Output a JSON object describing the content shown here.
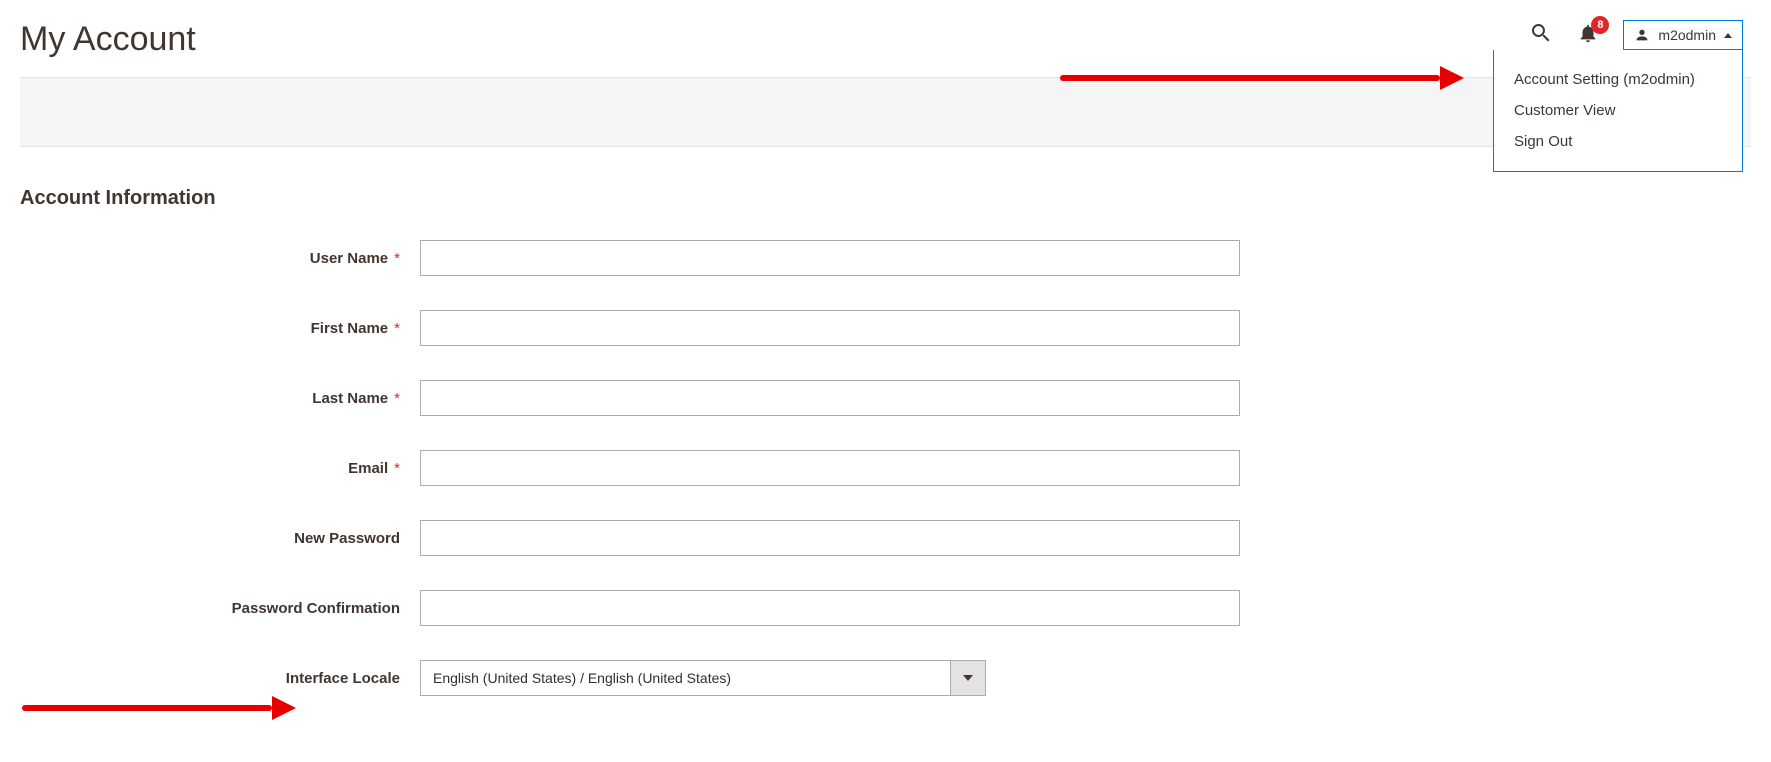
{
  "page": {
    "title": "My Account",
    "section_heading": "Account Information"
  },
  "header": {
    "notification_count": "8",
    "username": "m2odmin",
    "toolbar_hint": "R",
    "dropdown": {
      "account_setting": "Account Setting (m2odmin)",
      "customer_view": "Customer View",
      "sign_out": "Sign Out"
    }
  },
  "form": {
    "labels": {
      "user_name": "User Name",
      "first_name": "First Name",
      "last_name": "Last Name",
      "email": "Email",
      "new_password": "New Password",
      "password_confirmation": "Password Confirmation",
      "interface_locale": "Interface Locale"
    },
    "values": {
      "user_name": "",
      "first_name": "",
      "last_name": "",
      "email": "",
      "new_password": "",
      "password_confirmation": "",
      "interface_locale": "English (United States) / English (United States)"
    },
    "required_marker": "*"
  }
}
